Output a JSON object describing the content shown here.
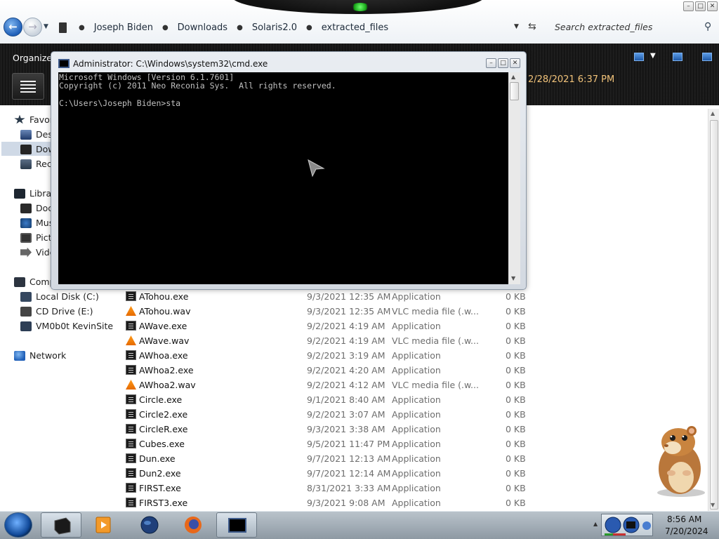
{
  "explorer": {
    "breadcrumb": [
      "Joseph Biden",
      "Downloads",
      "Solaris2.0",
      "extracted_files"
    ],
    "search_placeholder": "Search extracted_files",
    "organize_label": "Organize",
    "details_date": "2/28/2021 6:37 PM"
  },
  "nav_pane": {
    "favorites": {
      "label": "Favori",
      "items": [
        "Desk",
        "Dow",
        "Rece"
      ]
    },
    "libraries": {
      "label": "Librar",
      "items": [
        "Doc",
        "Mus",
        "Pict",
        "Vide"
      ]
    },
    "computer": {
      "label": "Comp",
      "items": [
        "Local Disk (C:)",
        "CD Drive (E:)",
        "VM0b0t KevinSite"
      ]
    },
    "network": {
      "label": "Network"
    }
  },
  "files": [
    {
      "name": "ATohou.exe",
      "date": "9/3/2021 12:35 AM",
      "type": "Application",
      "size": "0 KB",
      "icon": "exe"
    },
    {
      "name": "ATohou.wav",
      "date": "9/3/2021 12:35 AM",
      "type": "VLC media file (.w...",
      "size": "0 KB",
      "icon": "wav"
    },
    {
      "name": "AWave.exe",
      "date": "9/2/2021 4:19 AM",
      "type": "Application",
      "size": "0 KB",
      "icon": "exe"
    },
    {
      "name": "AWave.wav",
      "date": "9/2/2021 4:19 AM",
      "type": "VLC media file (.w...",
      "size": "0 KB",
      "icon": "wav"
    },
    {
      "name": "AWhoa.exe",
      "date": "9/2/2021 3:19 AM",
      "type": "Application",
      "size": "0 KB",
      "icon": "exe"
    },
    {
      "name": "AWhoa2.exe",
      "date": "9/2/2021 4:20 AM",
      "type": "Application",
      "size": "0 KB",
      "icon": "exe"
    },
    {
      "name": "AWhoa2.wav",
      "date": "9/2/2021 4:12 AM",
      "type": "VLC media file (.w...",
      "size": "0 KB",
      "icon": "wav"
    },
    {
      "name": "Circle.exe",
      "date": "9/1/2021 8:40 AM",
      "type": "Application",
      "size": "0 KB",
      "icon": "exe"
    },
    {
      "name": "Circle2.exe",
      "date": "9/2/2021 3:07 AM",
      "type": "Application",
      "size": "0 KB",
      "icon": "exe"
    },
    {
      "name": "CircleR.exe",
      "date": "9/3/2021 3:38 AM",
      "type": "Application",
      "size": "0 KB",
      "icon": "exe"
    },
    {
      "name": "Cubes.exe",
      "date": "9/5/2021 11:47 PM",
      "type": "Application",
      "size": "0 KB",
      "icon": "exe"
    },
    {
      "name": "Dun.exe",
      "date": "9/7/2021 12:13 AM",
      "type": "Application",
      "size": "0 KB",
      "icon": "exe"
    },
    {
      "name": "Dun2.exe",
      "date": "9/7/2021 12:14 AM",
      "type": "Application",
      "size": "0 KB",
      "icon": "exe"
    },
    {
      "name": "FIRST.exe",
      "date": "8/31/2021 3:33 AM",
      "type": "Application",
      "size": "0 KB",
      "icon": "exe"
    },
    {
      "name": "FIRST3.exe",
      "date": "9/3/2021 9:08 AM",
      "type": "Application",
      "size": "0 KB",
      "icon": "exe"
    }
  ],
  "cmd": {
    "title": "Administrator: C:\\Windows\\system32\\cmd.exe",
    "output": "Microsoft Windows [Version 6.1.7601]\nCopyright (c) 2011 Neo Reconia Sys.  All rights reserved.\n\nC:\\Users\\Joseph Biden>sta"
  },
  "taskbar": {
    "time": "8:56 AM",
    "date": "7/20/2024"
  },
  "colors": {
    "console_bg": "#000000",
    "console_text": "#c0c0c0",
    "details_date": "#f2c37a",
    "nav_selected": "#cfd9e6"
  }
}
